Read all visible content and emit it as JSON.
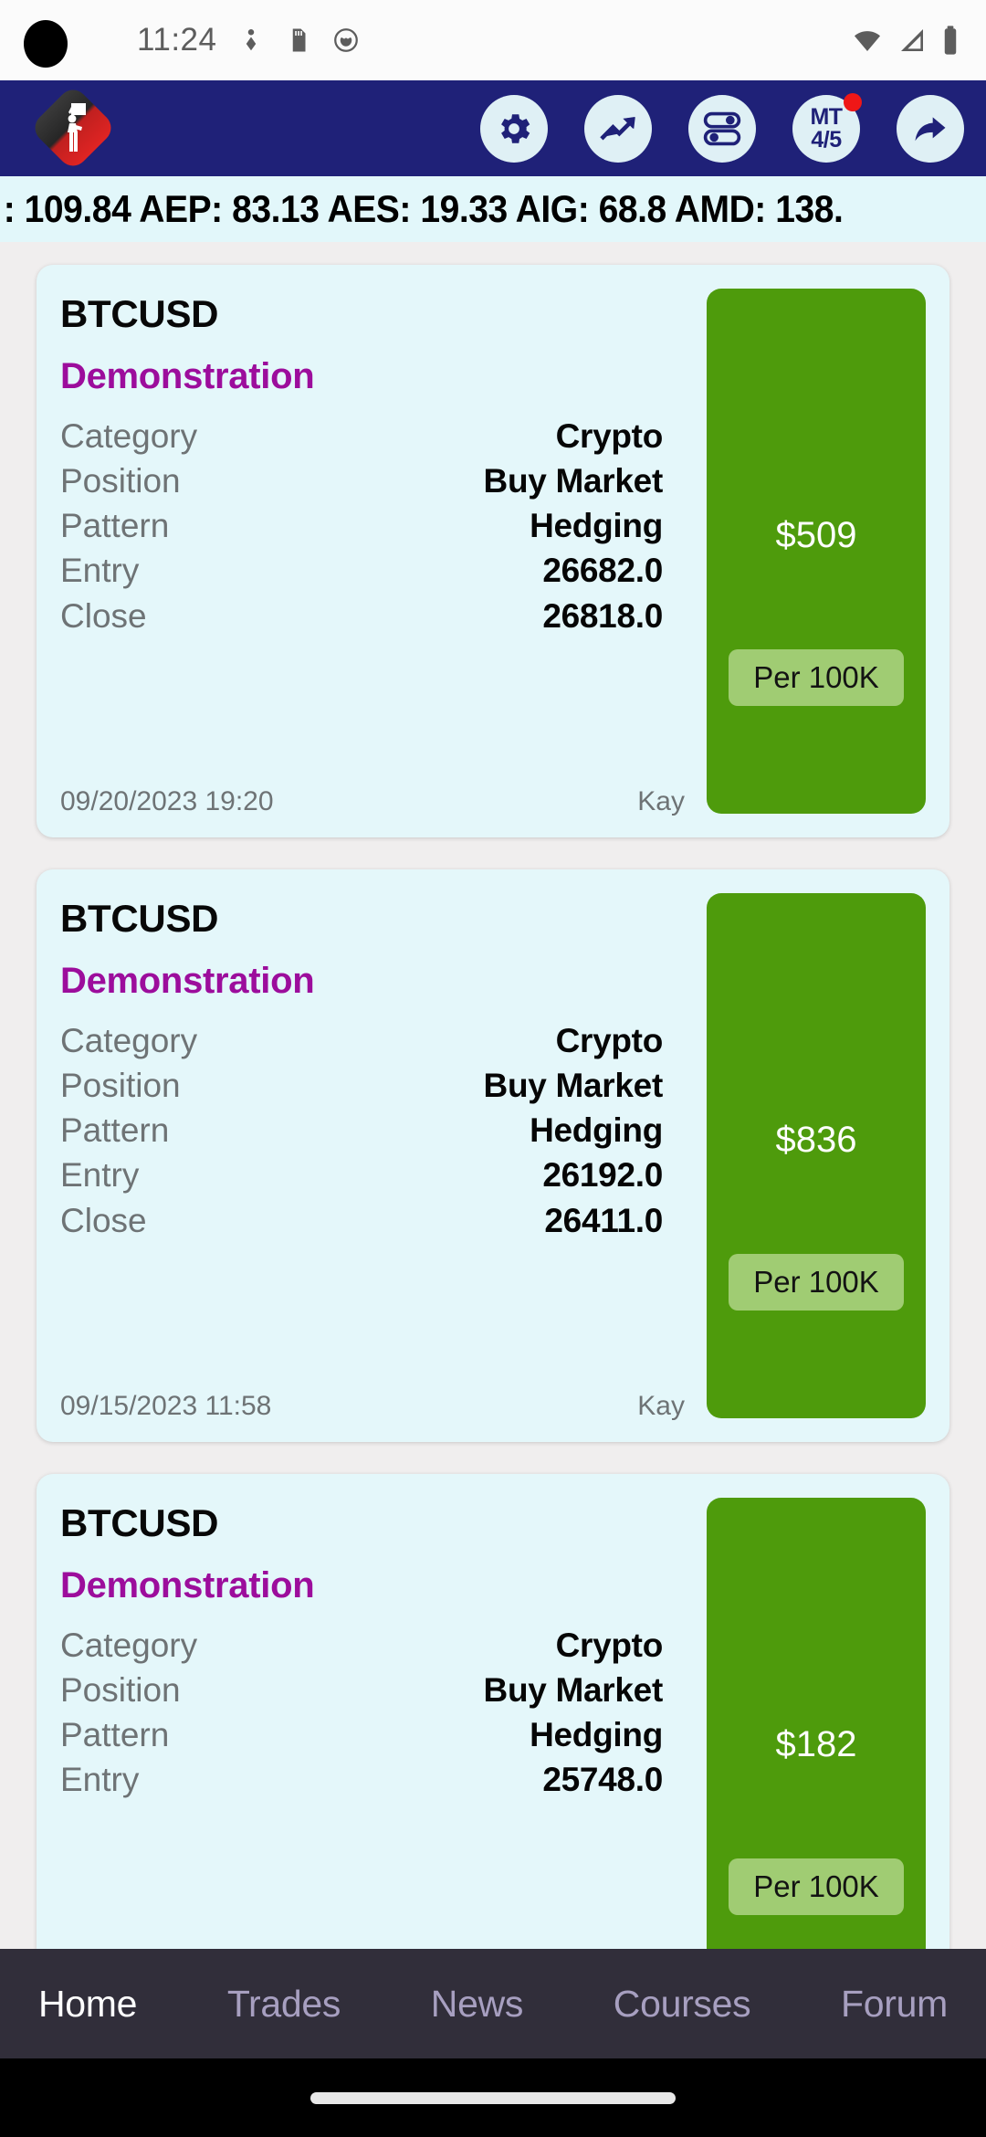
{
  "status_bar": {
    "time": "11:24",
    "icons": [
      "person-badge-icon",
      "sd-card-icon",
      "face-circle-icon"
    ],
    "right_icons": [
      "wifi-icon",
      "signal-icon",
      "battery-icon"
    ]
  },
  "app_bar": {
    "logo_name": "trader-academy-logo",
    "buttons": [
      {
        "name": "settings-button",
        "icon": "gear-icon",
        "label": ""
      },
      {
        "name": "analytics-button",
        "icon": "trending-up-icon",
        "label": ""
      },
      {
        "name": "toggles-button",
        "icon": "sliders-toggle-icon",
        "label": ""
      },
      {
        "name": "mt-account-button",
        "icon": "mt-badge-icon",
        "label": "MT",
        "sub_label": "4/5",
        "badge": true
      },
      {
        "name": "share-button",
        "icon": "share-arrow-icon",
        "label": ""
      }
    ]
  },
  "ticker": {
    "text": ": 109.84  AEP: 83.13  AES: 19.33  AIG: 68.8  AMD: 138.",
    "quotes": [
      {
        "symbol": "AEP",
        "price": "83.13"
      },
      {
        "symbol": "AES",
        "price": "19.33"
      },
      {
        "symbol": "AIG",
        "price": "68.8"
      },
      {
        "symbol": "AMD",
        "price": "138."
      }
    ]
  },
  "row_labels": {
    "category": "Category",
    "position": "Position",
    "pattern": "Pattern",
    "entry": "Entry",
    "close": "Close"
  },
  "cards": [
    {
      "symbol": "BTCUSD",
      "account": "Demonstration",
      "category": "Crypto",
      "position": "Buy Market",
      "pattern": "Hedging",
      "entry": "26682.0",
      "close": "26818.0",
      "timestamp": "09/20/2023 19:20",
      "author": "Kay",
      "profit": "$509",
      "profit_note": "Per 100K",
      "profit_color": "#4e9b0c"
    },
    {
      "symbol": "BTCUSD",
      "account": "Demonstration",
      "category": "Crypto",
      "position": "Buy Market",
      "pattern": "Hedging",
      "entry": "26192.0",
      "close": "26411.0",
      "timestamp": "09/15/2023 11:58",
      "author": "Kay",
      "profit": "$836",
      "profit_note": "Per 100K",
      "profit_color": "#4e9b0c"
    },
    {
      "symbol": "BTCUSD",
      "account": "Demonstration",
      "category": "Crypto",
      "position": "Buy Market",
      "pattern": "Hedging",
      "entry": "25748.0",
      "close": "",
      "timestamp": "",
      "author": "",
      "profit": "$182",
      "profit_note": "Per 100K",
      "profit_color": "#4e9b0c"
    }
  ],
  "bottom_nav": {
    "items": [
      {
        "label": "Home",
        "active": true
      },
      {
        "label": "Trades",
        "active": false
      },
      {
        "label": "News",
        "active": false
      },
      {
        "label": "Courses",
        "active": false
      },
      {
        "label": "Forum",
        "active": false
      }
    ]
  },
  "colors": {
    "app_bar": "#1f2178",
    "card_bg": "#e4f7fa",
    "accent_purple": "#9c0d9c",
    "profit_green": "#4e9b0c",
    "nav_bg": "#312e3a",
    "page_bg": "#f0eeee"
  }
}
